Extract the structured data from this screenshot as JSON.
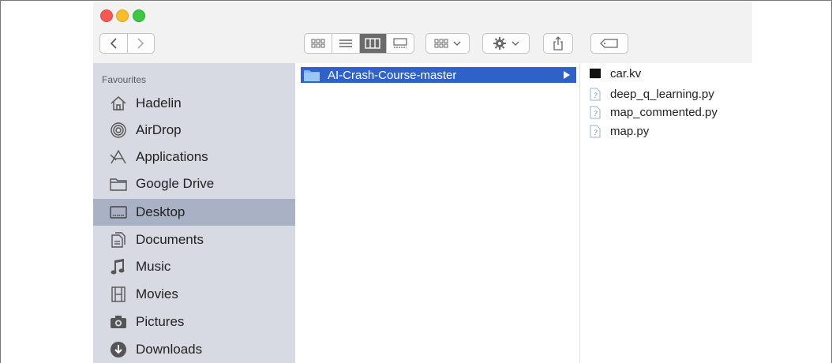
{
  "sidebar": {
    "heading": "Favourites",
    "items": [
      {
        "label": "Hadelin",
        "icon": "home-icon"
      },
      {
        "label": "AirDrop",
        "icon": "airdrop-icon"
      },
      {
        "label": "Applications",
        "icon": "applications-icon"
      },
      {
        "label": "Google Drive",
        "icon": "folder-icon"
      },
      {
        "label": "Desktop",
        "icon": "desktop-icon",
        "selected": true
      },
      {
        "label": "Documents",
        "icon": "documents-icon"
      },
      {
        "label": "Music",
        "icon": "music-icon"
      },
      {
        "label": "Movies",
        "icon": "movies-icon"
      },
      {
        "label": "Pictures",
        "icon": "camera-icon"
      },
      {
        "label": "Downloads",
        "icon": "downloads-icon"
      }
    ]
  },
  "column2": {
    "items": [
      {
        "label": "AI-Crash-Course-master",
        "icon": "folder-icon",
        "selected": true
      }
    ]
  },
  "column3": {
    "items": [
      {
        "label": "car.kv",
        "icon": "black-file-icon"
      },
      {
        "label": "deep_q_learning.py",
        "icon": "python-file-icon"
      },
      {
        "label": "map_commented.py",
        "icon": "python-file-icon"
      },
      {
        "label": "map.py",
        "icon": "python-file-icon"
      }
    ]
  },
  "colors": {
    "sidebar_bg": "#d7dae3",
    "sidebar_selected": "#a9b1c4",
    "selection_blue": "#2f62c9"
  }
}
